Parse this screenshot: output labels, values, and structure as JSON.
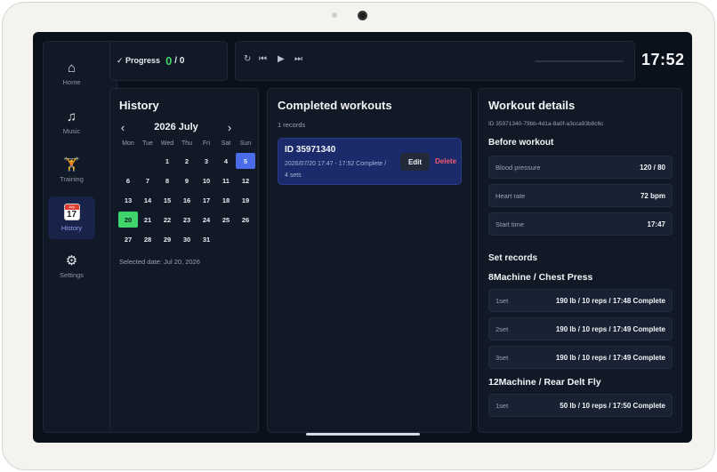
{
  "progress": {
    "label": "✓ Progress",
    "done": "0",
    "total": "/ 0"
  },
  "player": {
    "repeat": "↻",
    "prev": "⏮",
    "play": "▶",
    "next": "⏭"
  },
  "clock": "17:52",
  "sidebar": {
    "items": [
      {
        "label": "Home",
        "icon": "⌂"
      },
      {
        "label": "Music",
        "icon": "♫"
      },
      {
        "label": "Training",
        "icon": "🏋"
      },
      {
        "label": "History",
        "icon_month": "July",
        "icon_day": "17"
      },
      {
        "label": "Settings",
        "icon": "⚙"
      }
    ]
  },
  "history": {
    "title": "History",
    "prev": "‹",
    "next": "›",
    "month": "2026 July",
    "weekdays": [
      "Mon",
      "Tue",
      "Wed",
      "Thu",
      "Fri",
      "Sat",
      "Sun"
    ],
    "weeks": [
      [
        "",
        "",
        "1",
        "2",
        "3",
        "4",
        "5"
      ],
      [
        "6",
        "7",
        "8",
        "9",
        "10",
        "11",
        "12"
      ],
      [
        "13",
        "14",
        "15",
        "16",
        "17",
        "18",
        "19"
      ],
      [
        "20",
        "21",
        "22",
        "23",
        "24",
        "25",
        "26"
      ],
      [
        "27",
        "28",
        "29",
        "30",
        "31",
        "",
        ""
      ]
    ],
    "selected_date": "Selected date: Jul 20, 2026"
  },
  "completed": {
    "title": "Completed workouts",
    "records": "1  records",
    "workout": {
      "id": "ID 35971340",
      "meta_line1": "2026/07/20 17:47 - 17:52 Complete /",
      "meta_line2": "4 sets",
      "edit": "Edit",
      "delete": "Delete"
    }
  },
  "details": {
    "title": "Workout details",
    "id": "ID 35971340-79bb-4d1a-8a0f-a3cca93b8c6c",
    "before_title": "Before workout",
    "before": [
      {
        "k": "Blood pressure",
        "v": "120 / 80"
      },
      {
        "k": "Heart rate",
        "v": "72 bpm"
      },
      {
        "k": "Start time",
        "v": "17:47"
      }
    ],
    "set_records_title": "Set records",
    "machines": [
      {
        "name": "8Machine  / Chest Press",
        "sets": [
          {
            "k": "1set",
            "v": "190 lb / 10  reps / 17:48 Complete"
          },
          {
            "k": "2set",
            "v": "190 lb / 10  reps / 17:49 Complete"
          },
          {
            "k": "3set",
            "v": "190 lb / 10  reps / 17:49 Complete"
          }
        ]
      },
      {
        "name": "12Machine  / Rear Delt Fly",
        "sets": [
          {
            "k": "1set",
            "v": "50 lb / 10  reps / 17:50 Complete"
          }
        ]
      }
    ]
  }
}
